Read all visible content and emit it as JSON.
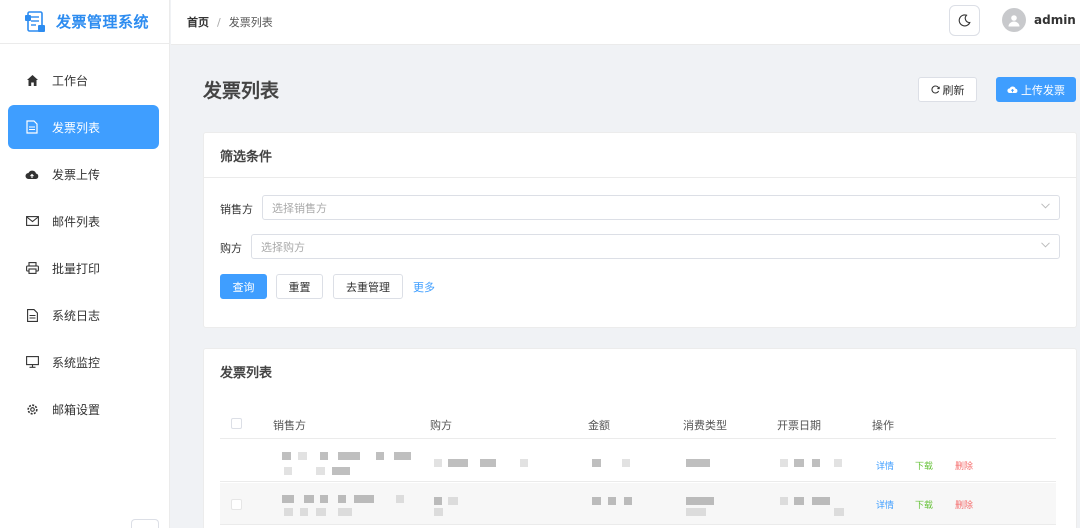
{
  "app": {
    "brand_title": "发票管理系统"
  },
  "sidebar": {
    "items": [
      {
        "label": "工作台",
        "icon": "home-icon",
        "active": false
      },
      {
        "label": "发票列表",
        "icon": "document-icon",
        "active": true
      },
      {
        "label": "发票上传",
        "icon": "cloud-upload-icon",
        "active": false
      },
      {
        "label": "邮件列表",
        "icon": "mail-icon",
        "active": false
      },
      {
        "label": "批量打印",
        "icon": "printer-icon",
        "active": false
      },
      {
        "label": "系统日志",
        "icon": "log-icon",
        "active": false
      },
      {
        "label": "系统监控",
        "icon": "monitor-icon",
        "active": false
      },
      {
        "label": "邮箱设置",
        "icon": "gear-icon",
        "active": false
      }
    ]
  },
  "header": {
    "breadcrumb": {
      "home": "首页",
      "separator": "/",
      "current": "发票列表"
    },
    "username": "admin"
  },
  "page": {
    "title": "发票列表",
    "refresh_label": "刷新",
    "upload_label": "上传发票"
  },
  "filter": {
    "title": "筛选条件",
    "seller_label": "销售方",
    "seller_placeholder": "选择销售方",
    "buyer_label": "购方",
    "buyer_placeholder": "选择购方",
    "query_label": "查询",
    "reset_label": "重置",
    "dedupe_label": "去重管理",
    "more_label": "更多"
  },
  "table": {
    "title": "发票列表",
    "columns": [
      "销售方",
      "购方",
      "金额",
      "消费类型",
      "开票日期",
      "操作"
    ],
    "row_actions": {
      "detail": "详情",
      "download": "下载",
      "delete": "删除"
    },
    "rows": 2
  },
  "colors": {
    "primary": "#3f9eff",
    "brand": "#2d8cf0",
    "success": "#67c23a",
    "danger": "#f56c6c"
  }
}
